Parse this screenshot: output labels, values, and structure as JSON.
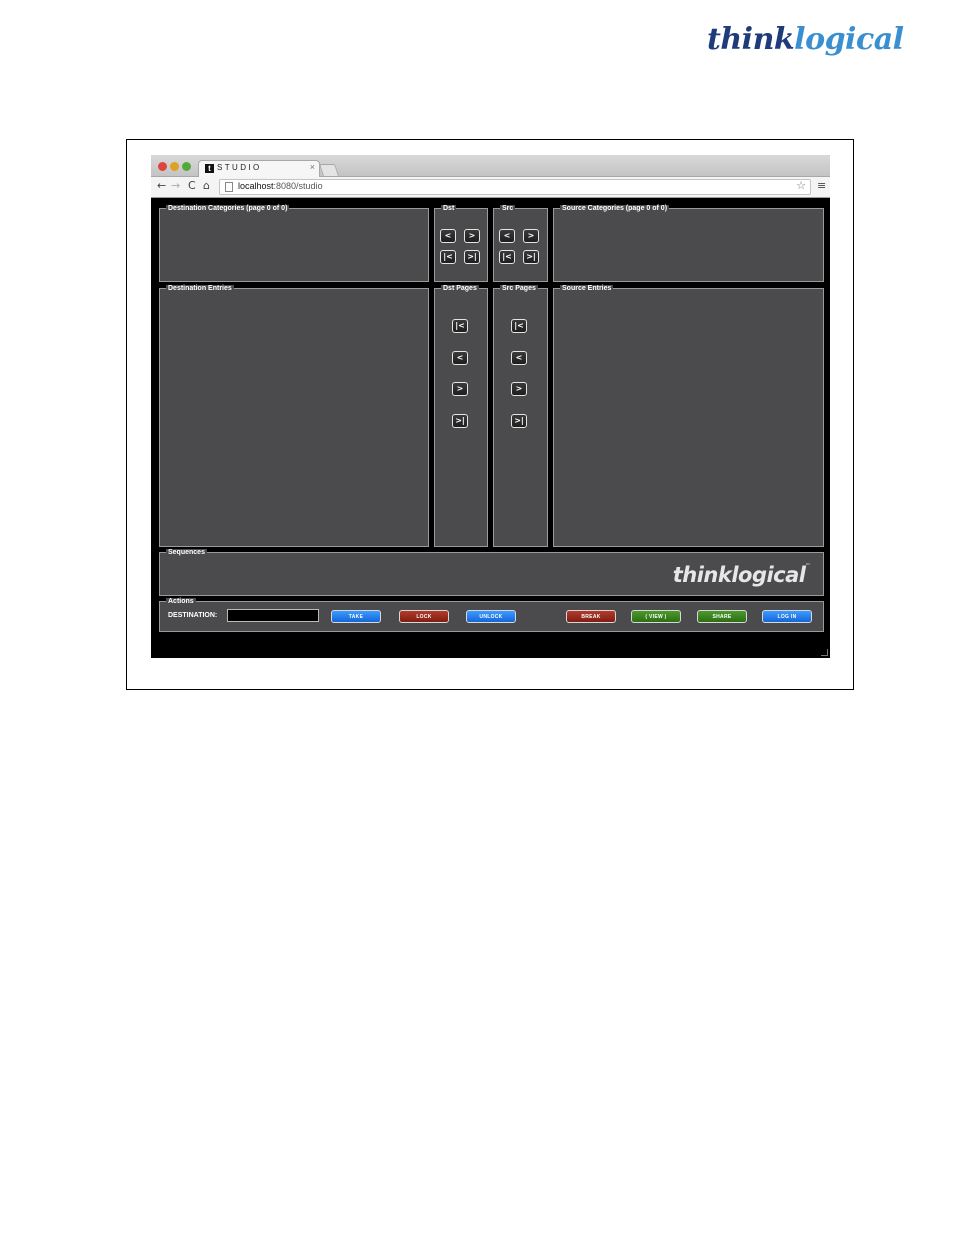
{
  "doc_logo": {
    "part1": "think",
    "part2": "logical"
  },
  "browser": {
    "tab_title": "STUDIO",
    "tab_favicon": "t",
    "tab_close": "×",
    "url_host": "localhost",
    "url_rest": ":8080/studio",
    "icons": {
      "back": "←",
      "forward": "→",
      "reload": "C",
      "home": "⌂",
      "star": "☆",
      "menu": "≡"
    }
  },
  "panels": {
    "dest_categories": "Destination Categories (page 0 of 0)",
    "dst": "Dst",
    "src": "Src",
    "source_categories": "Source Categories (page 0 of 0)",
    "dest_entries": "Destination Entries",
    "dst_pages": "Dst Pages",
    "src_pages": "Src Pages",
    "source_entries": "Source Entries",
    "sequences": "Sequences",
    "actions": "Actions"
  },
  "nav_buttons": {
    "prev": "<",
    "next": ">",
    "first": "|<",
    "last": ">|"
  },
  "app_logo": {
    "text": "thinklogical",
    "tm": "™"
  },
  "actions": {
    "destination_label": "DESTINATION:",
    "destination_value": "",
    "take": "TAKE",
    "lock": "LOCK",
    "unlock": "UNLOCK",
    "break": "BREAK",
    "view": "( VIEW )",
    "share": "SHARE",
    "login": "LOG IN"
  }
}
